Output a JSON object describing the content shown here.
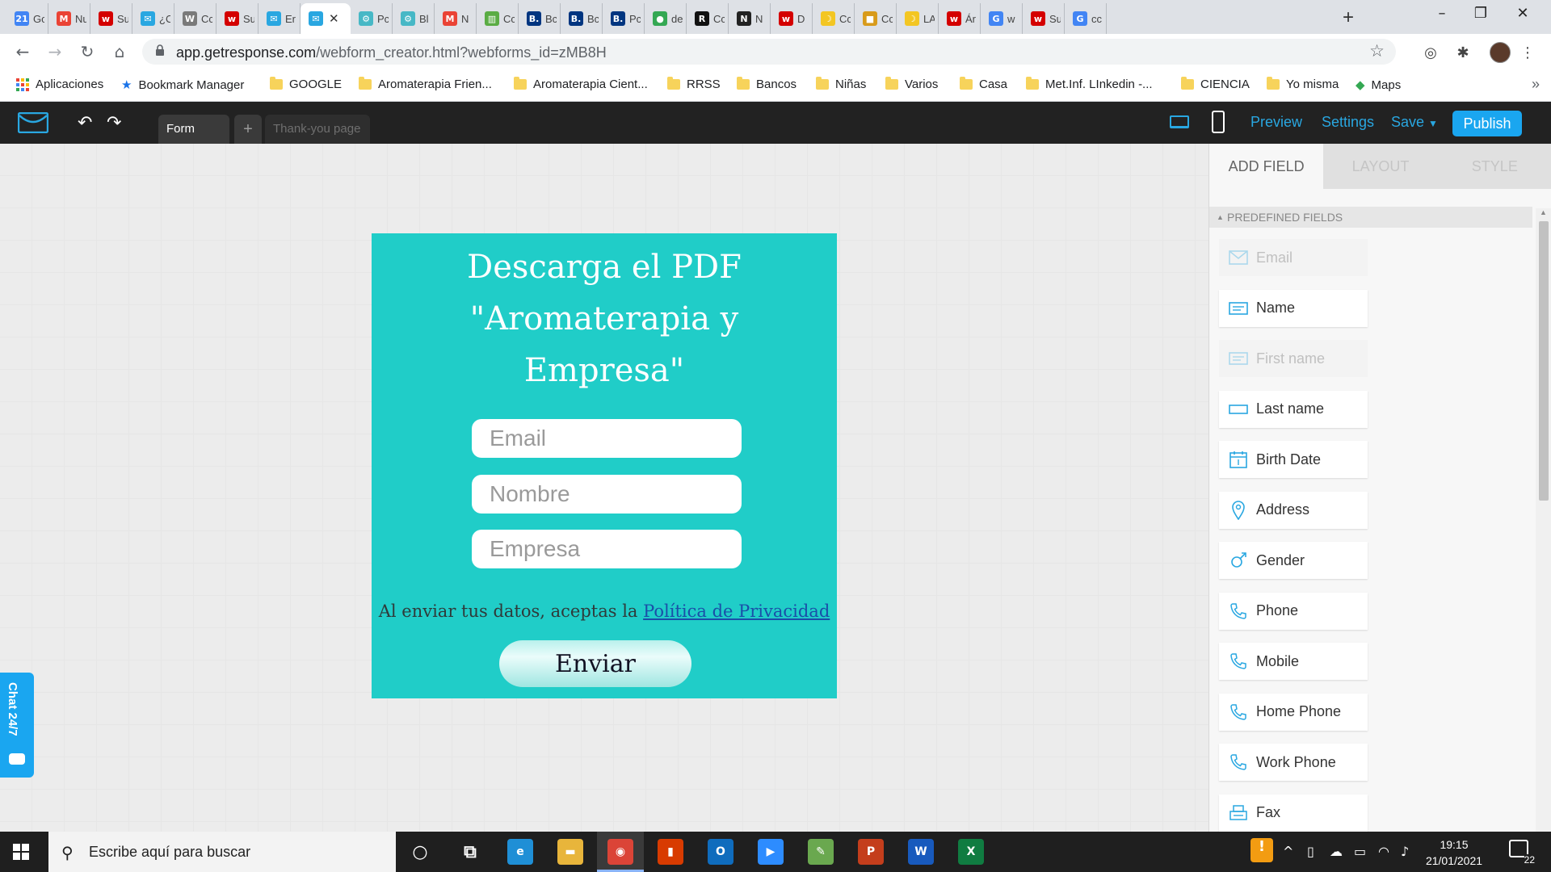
{
  "browser": {
    "tabs": [
      {
        "label": "Go",
        "icon": "calendar-icon",
        "color": "#4285f4",
        "glyph": "21"
      },
      {
        "label": "Nu",
        "icon": "gmail-icon",
        "color": "#ea4335",
        "glyph": "M"
      },
      {
        "label": "Su",
        "icon": "wix-icon",
        "color": "#d40000",
        "glyph": "w"
      },
      {
        "label": "¿C",
        "icon": "mail-icon",
        "color": "#29a7e1",
        "glyph": "✉"
      },
      {
        "label": "Cc",
        "icon": "wordpress-icon",
        "color": "#7a7a7a",
        "glyph": "W"
      },
      {
        "label": "Su",
        "icon": "wix-icon",
        "color": "#d40000",
        "glyph": "w"
      },
      {
        "label": "Er",
        "icon": "mail-icon",
        "color": "#29a7e1",
        "glyph": "✉"
      },
      {
        "label": "",
        "icon": "mail-icon",
        "color": "#29a7e1",
        "glyph": "✉",
        "active": true
      },
      {
        "label": "Pc",
        "icon": "gear-icon",
        "color": "#47b8c6",
        "glyph": "⚙"
      },
      {
        "label": "Bl",
        "icon": "gear-icon",
        "color": "#47b8c6",
        "glyph": "⚙"
      },
      {
        "label": "N",
        "icon": "gmail-icon",
        "color": "#ea4335",
        "glyph": "M"
      },
      {
        "label": "Cc",
        "icon": "trello-icon",
        "color": "#5aac44",
        "glyph": "▥"
      },
      {
        "label": "Bc",
        "icon": "booking-icon",
        "color": "#003580",
        "glyph": "B."
      },
      {
        "label": "Bc",
        "icon": "booking-icon",
        "color": "#003580",
        "glyph": "B."
      },
      {
        "label": "Pc",
        "icon": "booking-icon",
        "color": "#003580",
        "glyph": "B."
      },
      {
        "label": "de",
        "icon": "maps-pin-icon",
        "color": "#34a853",
        "glyph": "●"
      },
      {
        "label": "Cc",
        "icon": "r-icon",
        "color": "#111111",
        "glyph": "R"
      },
      {
        "label": "N",
        "icon": "notion-icon",
        "color": "#222222",
        "glyph": "N"
      },
      {
        "label": "D",
        "icon": "wix-icon",
        "color": "#d40000",
        "glyph": "w"
      },
      {
        "label": "Cc",
        "icon": "moon-icon",
        "color": "#f3c623",
        "glyph": "☽"
      },
      {
        "label": "Cc",
        "icon": "box-icon",
        "color": "#d89b1b",
        "glyph": "■"
      },
      {
        "label": "LA",
        "icon": "moon-icon",
        "color": "#f3c623",
        "glyph": "☽"
      },
      {
        "label": "Ár",
        "icon": "wix-icon",
        "color": "#d40000",
        "glyph": "w"
      },
      {
        "label": "w",
        "icon": "google-icon",
        "color": "#4285f4",
        "glyph": "G"
      },
      {
        "label": "Su",
        "icon": "wix-icon",
        "color": "#d40000",
        "glyph": "w"
      },
      {
        "label": "cc",
        "icon": "google-icon",
        "color": "#4285f4",
        "glyph": "G"
      }
    ],
    "url_host": "app.getresponse.com",
    "url_path": "/webform_creator.html?webforms_id=zMB8H",
    "bookmarks": [
      {
        "label": "Aplicaciones",
        "type": "apps"
      },
      {
        "label": "Bookmark Manager",
        "type": "star"
      },
      {
        "label": "GOOGLE",
        "type": "folder"
      },
      {
        "label": "Aromaterapia Frien...",
        "type": "folder"
      },
      {
        "label": "Aromaterapia Cient...",
        "type": "folder"
      },
      {
        "label": "RRSS",
        "type": "folder"
      },
      {
        "label": "Bancos",
        "type": "folder"
      },
      {
        "label": "Niñas",
        "type": "folder"
      },
      {
        "label": "Varios",
        "type": "folder"
      },
      {
        "label": "Casa",
        "type": "folder"
      },
      {
        "label": "Met.Inf. LInkedin -...",
        "type": "folder"
      },
      {
        "label": "CIENCIA",
        "type": "folder"
      },
      {
        "label": "Yo misma",
        "type": "folder"
      },
      {
        "label": "Maps",
        "type": "maps"
      }
    ],
    "bookmarks_more": "»"
  },
  "app": {
    "tabs": {
      "form": "Form",
      "add": "+",
      "thankyou": "Thank-you page"
    },
    "actions": {
      "preview": "Preview",
      "settings": "Settings",
      "save": "Save",
      "publish": "Publish"
    },
    "accent": "#1aa6f0"
  },
  "form": {
    "title": "Descarga el PDF \"Aromaterapia y Empresa\"",
    "fields": [
      {
        "placeholder": "Email"
      },
      {
        "placeholder": "Nombre"
      },
      {
        "placeholder": "Empresa"
      }
    ],
    "consent_text": "Al enviar tus datos, aceptas la ",
    "consent_link": "Política de Privacidad",
    "submit": "Enviar",
    "background": "#20cdc8"
  },
  "chat": {
    "label": "Chat 24/7"
  },
  "panel": {
    "tabs": [
      "ADD FIELD",
      "LAYOUT",
      "STYLE"
    ],
    "section": "PREDEFINED FIELDS",
    "fields": [
      {
        "label": "Email",
        "icon": "envelope-icon",
        "disabled": true
      },
      {
        "label": "Name",
        "icon": "name-field-icon",
        "disabled": false
      },
      {
        "label": "First name",
        "icon": "name-field-icon",
        "disabled": true
      },
      {
        "label": "Last name",
        "icon": "text-field-icon",
        "disabled": false
      },
      {
        "label": "Birth Date",
        "icon": "calendar-icon",
        "disabled": false
      },
      {
        "label": "Address",
        "icon": "map-pin-icon",
        "disabled": false
      },
      {
        "label": "Gender",
        "icon": "gender-icon",
        "disabled": false
      },
      {
        "label": "Phone",
        "icon": "phone-icon",
        "disabled": false
      },
      {
        "label": "Mobile",
        "icon": "phone-icon",
        "disabled": false
      },
      {
        "label": "Home Phone",
        "icon": "phone-icon",
        "disabled": false
      },
      {
        "label": "Work Phone",
        "icon": "phone-icon",
        "disabled": false
      },
      {
        "label": "Fax",
        "icon": "fax-icon",
        "disabled": false
      }
    ]
  },
  "taskbar": {
    "search_placeholder": "Escribe aquí para buscar",
    "apps": [
      {
        "name": "cortana-icon",
        "glyph": "○",
        "color": "transparent"
      },
      {
        "name": "task-view-icon",
        "glyph": "⧉",
        "color": "transparent"
      },
      {
        "name": "edge-icon",
        "glyph": "e",
        "color": "#1f8fd6"
      },
      {
        "name": "file-explorer-icon",
        "glyph": "▬",
        "color": "#e8b53b"
      },
      {
        "name": "chrome-icon",
        "glyph": "◉",
        "color": "#db4437",
        "active": true
      },
      {
        "name": "office-icon",
        "glyph": "▮",
        "color": "#d83b01"
      },
      {
        "name": "outlook-icon",
        "glyph": "O",
        "color": "#0f6cbd"
      },
      {
        "name": "zoom-icon",
        "glyph": "▶",
        "color": "#2d8cff"
      },
      {
        "name": "paint-icon",
        "glyph": "✎",
        "color": "#6aa84f"
      },
      {
        "name": "powerpoint-icon",
        "glyph": "P",
        "color": "#c43e1c"
      },
      {
        "name": "word-icon",
        "glyph": "W",
        "color": "#185abd"
      },
      {
        "name": "excel-icon",
        "glyph": "X",
        "color": "#107c41"
      }
    ],
    "time": "19:15",
    "date": "21/01/2021",
    "notifications": "22"
  }
}
